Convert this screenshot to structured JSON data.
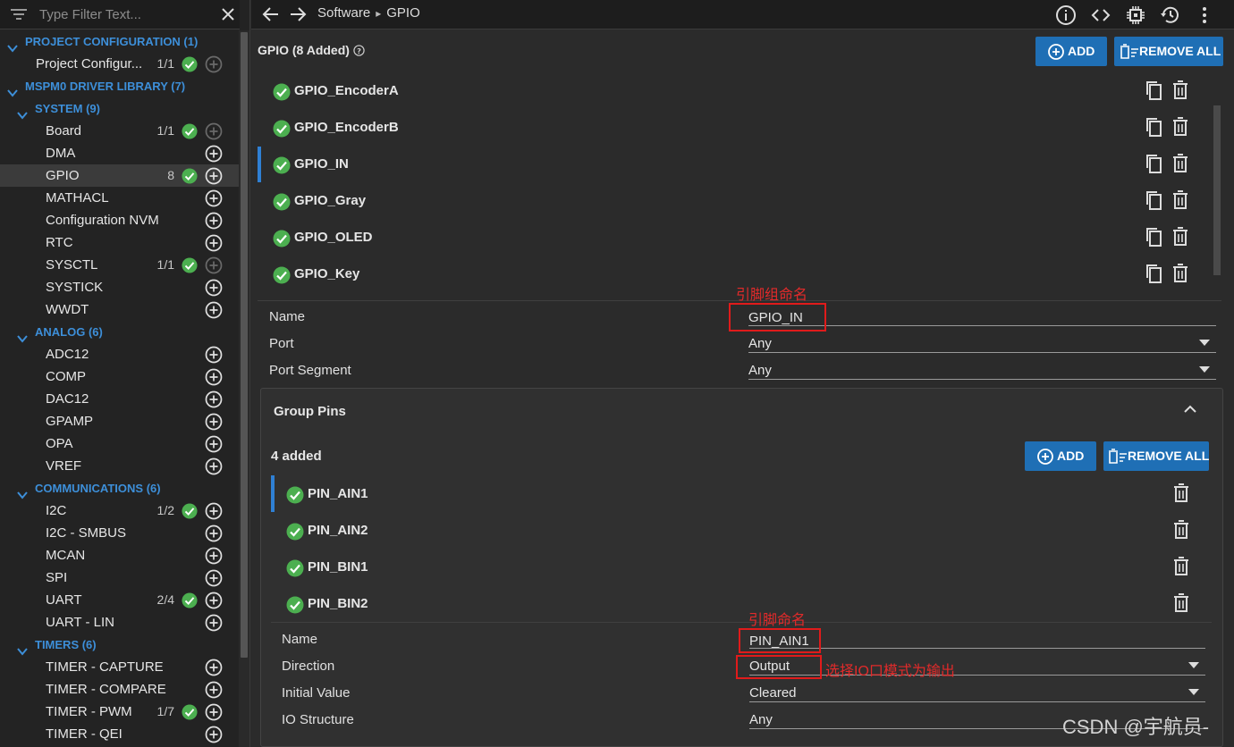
{
  "sidebar": {
    "filter_placeholder": "Type Filter Text...",
    "project_configuration": {
      "label": "PROJECT CONFIGURATION (1)",
      "item": {
        "label": "Project Configur...",
        "count": "1/1"
      }
    },
    "driver_library": {
      "label": "MSPM0 DRIVER LIBRARY (7)"
    },
    "system": {
      "label": "SYSTEM (9)",
      "items": [
        {
          "label": "Board",
          "count": "1/1"
        },
        {
          "label": "DMA",
          "count": ""
        },
        {
          "label": "GPIO",
          "count": "8"
        },
        {
          "label": "MATHACL",
          "count": ""
        },
        {
          "label": "Configuration NVM",
          "count": ""
        },
        {
          "label": "RTC",
          "count": ""
        },
        {
          "label": "SYSCTL",
          "count": "1/1"
        },
        {
          "label": "SYSTICK",
          "count": ""
        },
        {
          "label": "WWDT",
          "count": ""
        }
      ]
    },
    "analog": {
      "label": "ANALOG (6)",
      "items": [
        {
          "label": "ADC12"
        },
        {
          "label": "COMP"
        },
        {
          "label": "DAC12"
        },
        {
          "label": "GPAMP"
        },
        {
          "label": "OPA"
        },
        {
          "label": "VREF"
        }
      ]
    },
    "communications": {
      "label": "COMMUNICATIONS (6)",
      "items": [
        {
          "label": "I2C",
          "count": "1/2"
        },
        {
          "label": "I2C - SMBUS",
          "count": ""
        },
        {
          "label": "MCAN",
          "count": ""
        },
        {
          "label": "SPI",
          "count": ""
        },
        {
          "label": "UART",
          "count": "2/4"
        },
        {
          "label": "UART - LIN",
          "count": ""
        }
      ]
    },
    "timers": {
      "label": "TIMERS (6)",
      "items": [
        {
          "label": "TIMER - CAPTURE",
          "count": ""
        },
        {
          "label": "TIMER - COMPARE",
          "count": ""
        },
        {
          "label": "TIMER - PWM",
          "count": "1/7"
        },
        {
          "label": "TIMER - QEI",
          "count": ""
        }
      ]
    }
  },
  "topbar": {
    "crumb1": "Software",
    "crumb2": "GPIO"
  },
  "main": {
    "title": "GPIO (8 Added)",
    "add_label": "ADD",
    "remove_all_label": "REMOVE ALL",
    "gpio_list": [
      "GPIO_EncoderA",
      "GPIO_EncoderB",
      "GPIO_IN",
      "GPIO_Gray",
      "GPIO_OLED",
      "GPIO_Key"
    ],
    "fields": {
      "name_label": "Name",
      "name_value": "GPIO_IN",
      "port_label": "Port",
      "port_value": "Any",
      "segment_label": "Port Segment",
      "segment_value": "Any"
    },
    "group_pins": {
      "title": "Group Pins",
      "added": "4 added",
      "add_label": "ADD",
      "remove_all_label": "REMOVE ALL",
      "pins": [
        "PIN_AIN1",
        "PIN_AIN2",
        "PIN_BIN1",
        "PIN_BIN2"
      ],
      "fields": {
        "name_label": "Name",
        "name_value": "PIN_AIN1",
        "direction_label": "Direction",
        "direction_value": "Output",
        "initial_label": "Initial Value",
        "initial_value": "Cleared",
        "io_label": "IO Structure",
        "io_value": "Any"
      }
    }
  },
  "annotations": {
    "group_name": "引脚组命名",
    "pin_name": "引脚命名",
    "direction": "选择IO口模式为输出"
  },
  "watermark": "CSDN @宇航员-",
  "colors": {
    "accent": "#3d8fd9",
    "button": "#1f6fb5",
    "check": "#4caf50",
    "highlight": "#e01b1b"
  }
}
